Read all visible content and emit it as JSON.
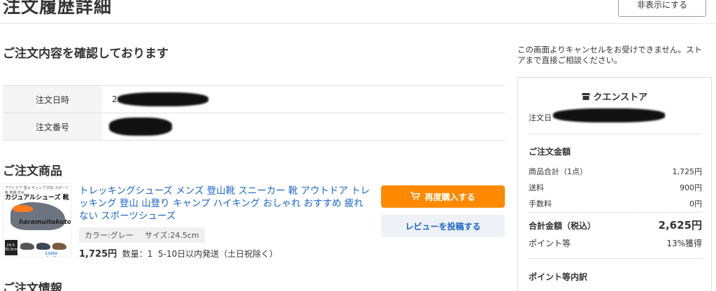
{
  "header": {
    "title": "注文履歴詳細",
    "hide_button": "非表示にする"
  },
  "confirm_section": {
    "heading": "ご注文内容を確認しております"
  },
  "order_info": {
    "date_label": "注文日時",
    "date_visible_prefix": "2",
    "number_label": "注文番号"
  },
  "product_section": {
    "heading": "ご注文商品",
    "product": {
      "title": "トレッキングシューズ メンズ 登山靴 スニーカー 靴 アウトドア トレッキング 登山 山登り キャンプ ハイキング おしゃれ おすすめ 疲れない スポーツシューズ",
      "tags": [
        "カラー:グレー",
        "サイズ:24.5cm"
      ],
      "price": "1,725円",
      "quantity": "数量：1",
      "shipping": "5-10日以内発送（土日祝除く）",
      "thumbnail": {
        "top_text": "アウトドア 登山 キャンプ 対応 スポーツ靴 軽量 防水",
        "title": "カジュアルシューズ 靴",
        "brand": "haramuitakuto",
        "size_badge": "24.5-30.0cm",
        "logo": "Linto Smile"
      }
    },
    "rebuy_button": "再度購入する",
    "review_button": "レビューを投稿する"
  },
  "order_detail_section": {
    "heading": "ご注文情報"
  },
  "sidebar": {
    "cancel_note": "この画面よりキャンセルをお受けできません。ストアまで直接ご相談ください。",
    "store_name": "クエンストア",
    "store_date_prefix": "注文日",
    "amount_heading": "ご注文金額",
    "rows": [
      {
        "label": "商品合計（1点）",
        "value": "1,725円"
      },
      {
        "label": "送料",
        "value": "900円"
      },
      {
        "label": "手数料",
        "value": "0円"
      }
    ],
    "total_label": "合計金額（税込）",
    "total_value": "2,625円",
    "points_label": "ポイント等",
    "points_value": "13%獲得",
    "points_breakdown_heading": "ポイント等内訳"
  },
  "colors": {
    "accent_orange": "#ff8a00",
    "link_blue": "#1a66cc"
  }
}
